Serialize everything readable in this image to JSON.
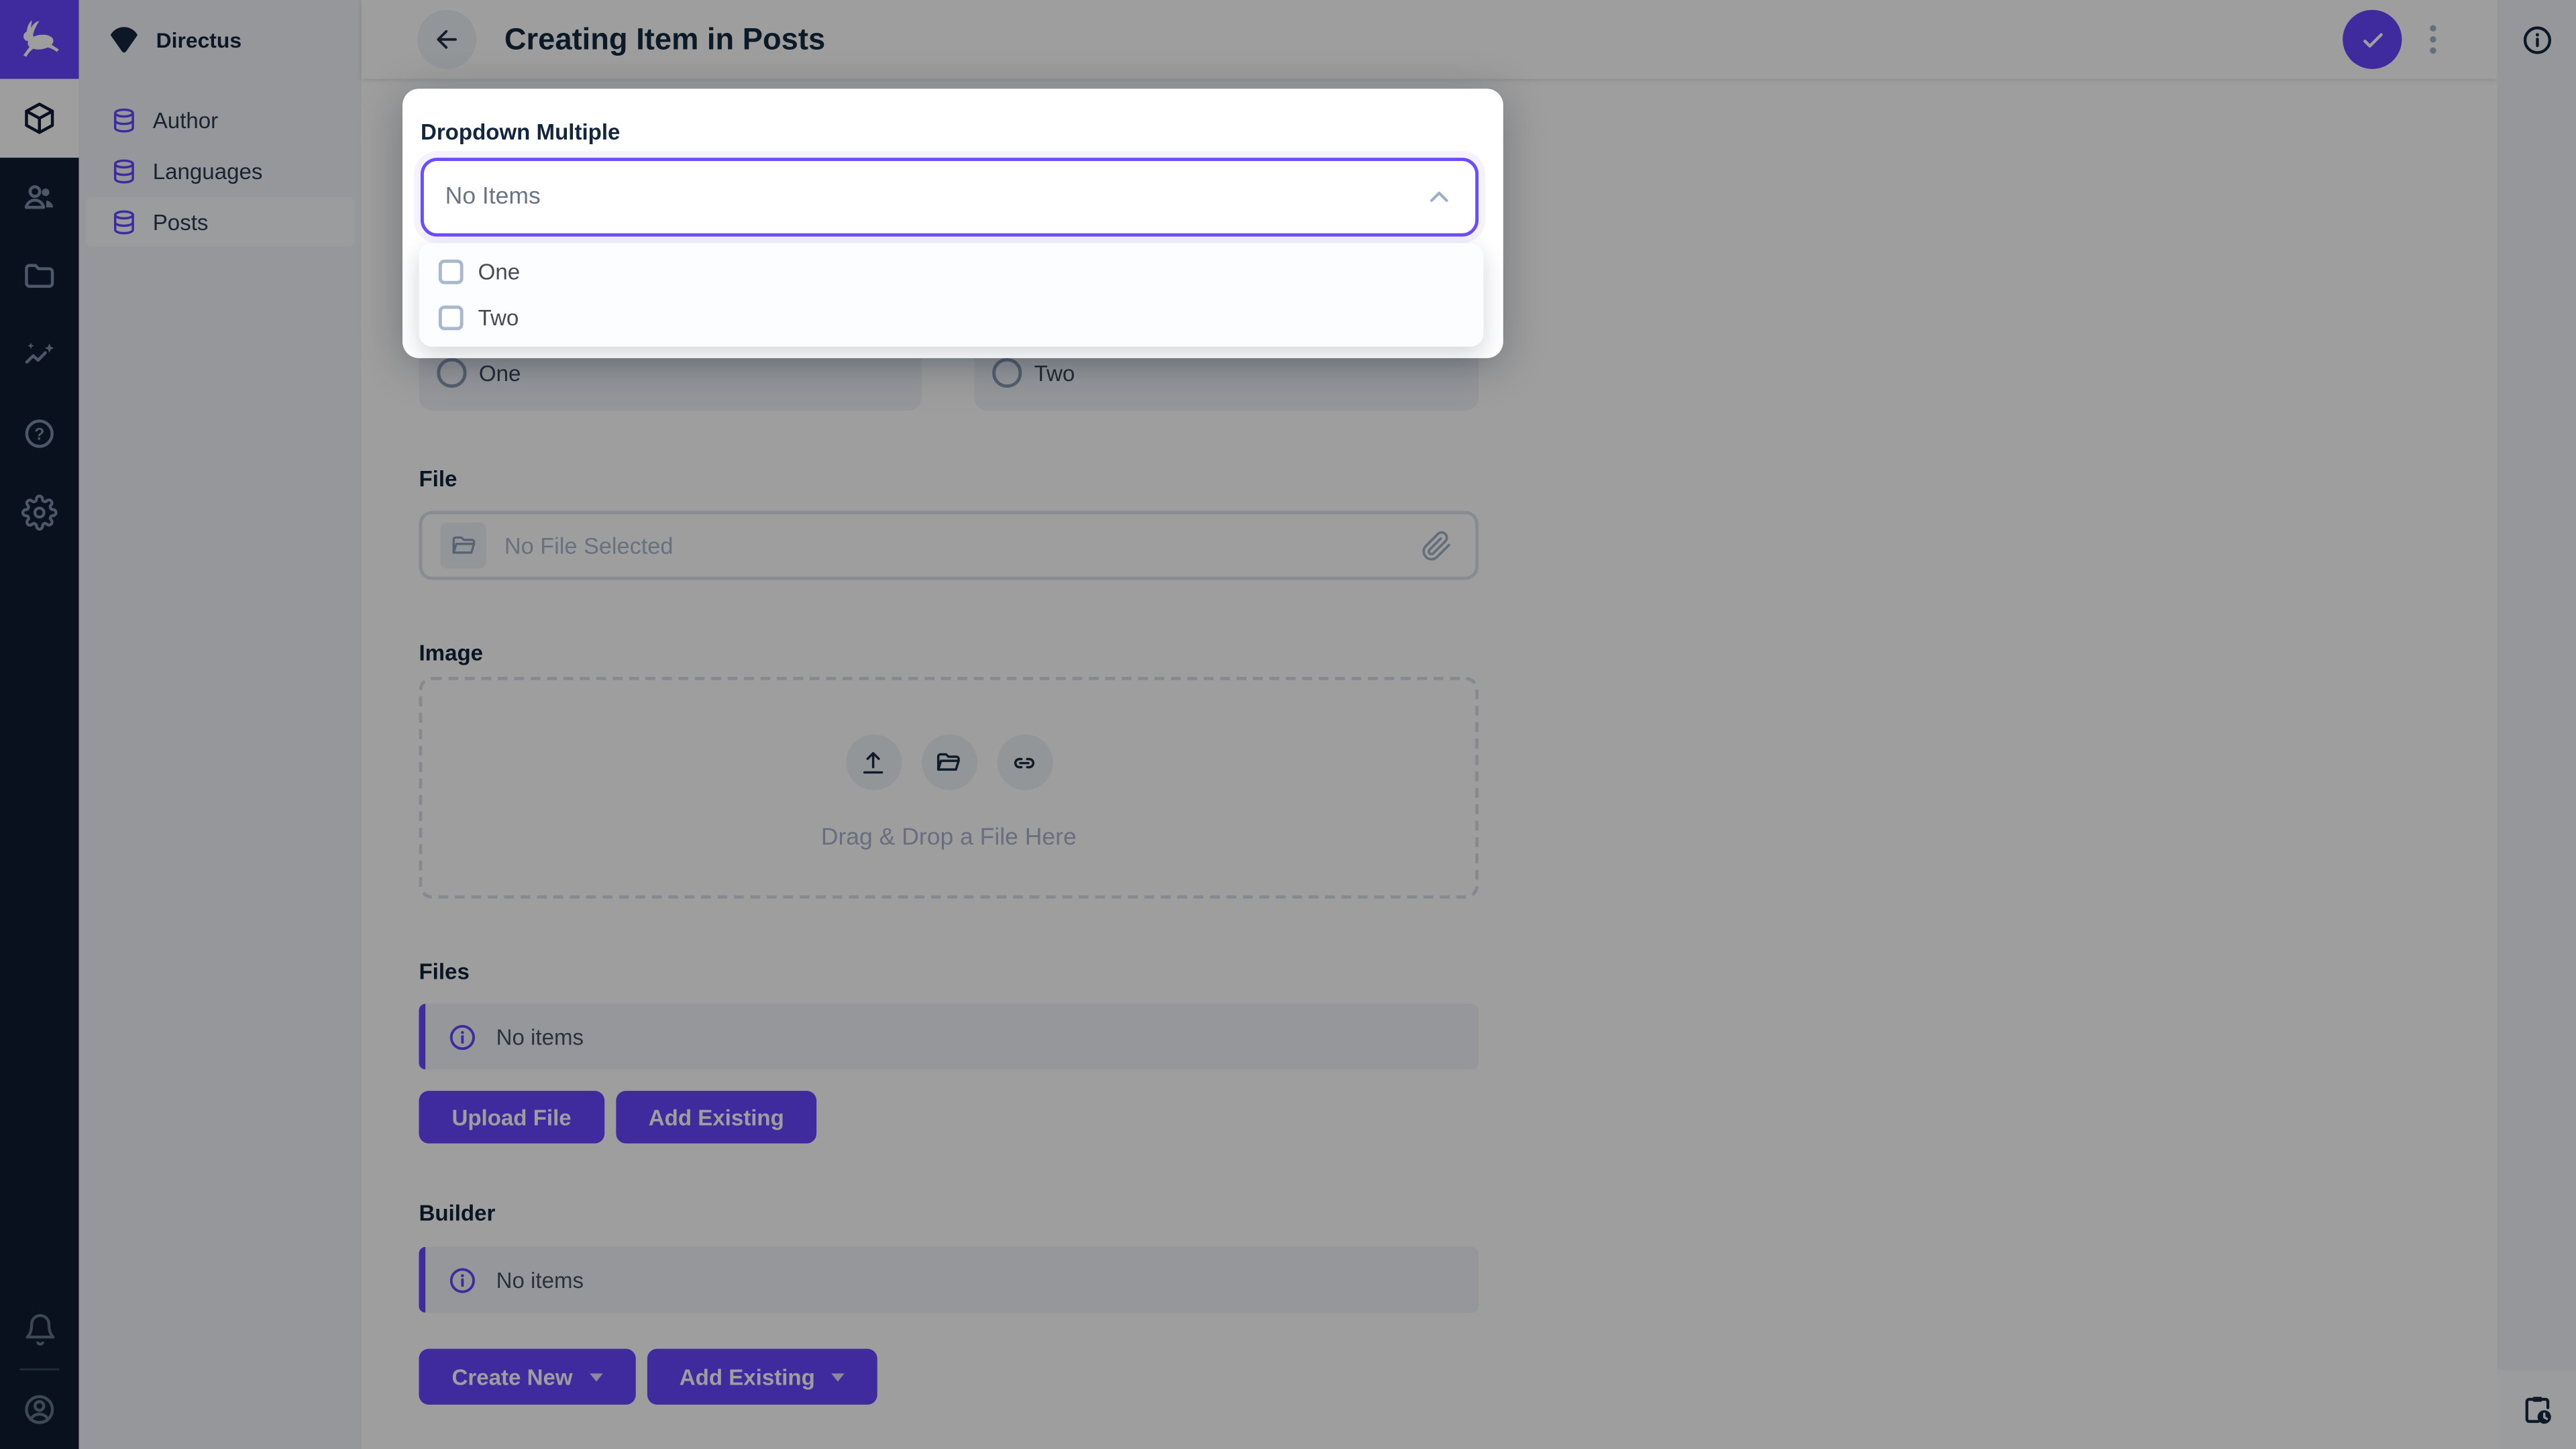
{
  "app": {
    "accent_color": "#6644ff",
    "module_bar_color": "#0e1c2f"
  },
  "nav": {
    "project_name": "Directus",
    "collections": [
      {
        "label": "Author",
        "active": false
      },
      {
        "label": "Languages",
        "active": false
      },
      {
        "label": "Posts",
        "active": true
      }
    ]
  },
  "header": {
    "title": "Creating Item in Posts"
  },
  "popover": {
    "field_label": "Dropdown Multiple",
    "select_value": "No Items",
    "options": [
      {
        "label": "One",
        "checked": false
      },
      {
        "label": "Two",
        "checked": false
      }
    ]
  },
  "form": {
    "radio_field": {
      "options": [
        {
          "label": "One",
          "selected": false
        },
        {
          "label": "Two",
          "selected": false
        }
      ]
    },
    "file_field": {
      "label": "File",
      "placeholder": "No File Selected"
    },
    "image_field": {
      "label": "Image",
      "dropzone_text": "Drag & Drop a File Here"
    },
    "files_field": {
      "label": "Files",
      "empty_text": "No items",
      "buttons": [
        {
          "label": "Upload File"
        },
        {
          "label": "Add Existing"
        }
      ]
    },
    "builder_field": {
      "label": "Builder",
      "empty_text": "No items",
      "buttons": [
        {
          "label": "Create New"
        },
        {
          "label": "Add Existing"
        }
      ]
    }
  }
}
